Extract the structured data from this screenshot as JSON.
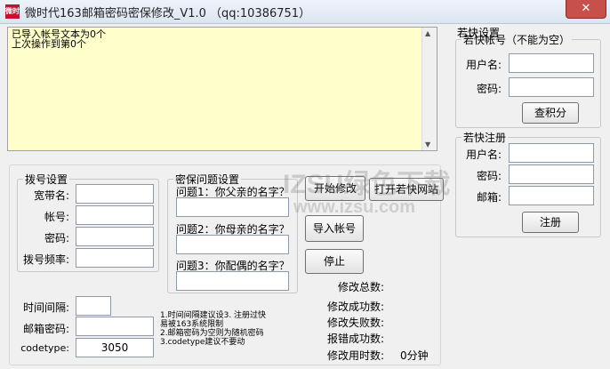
{
  "titlebar": {
    "app_icon_text": "微时",
    "title": "微时代163邮箱密码密保修改_V1.0  （qq:10386751）",
    "close_glyph": "✕"
  },
  "log": {
    "lines": "已导入帐号文本为0个\n上次操作到第0个"
  },
  "dial": {
    "legend": "拨号设置",
    "broadband_label": "宽带名:",
    "account_label": "帐号:",
    "password_label": "密码:",
    "frequency_label": "拨号频率:"
  },
  "security": {
    "legend": "密保问题设置",
    "q1": "问题1：你父亲的名字？",
    "q2": "问题2：你母亲的名字？",
    "q3": "问题3：你配偶的名字？"
  },
  "actions": {
    "start": "开始修改",
    "open_site": "打开若快网站",
    "import": "导入帐号",
    "stop": "停止"
  },
  "stats": {
    "total": "修改总数:",
    "success": "修改成功数:",
    "fail": "修改失败数:",
    "error_success": "报错成功数:",
    "time_used": "修改用时数:",
    "time_value": "0分钟"
  },
  "bottom": {
    "interval_label": "时间间隔:",
    "mail_password_label": "邮箱密码:",
    "codetype_label": "codetype:",
    "codetype_value": "3050",
    "notes": "1.时间间隔建议设3. 注册过快\n易被163系统限制\n2.邮箱密码为空则为随机密码\n3.codetype建议不要动"
  },
  "ruokuai": {
    "legend": "若快设置",
    "account_legend": "若快帐号（不能为空）",
    "username_label": "用户名:",
    "password_label": "密码:",
    "check_points": "查积分",
    "register_legend": "若快注册",
    "reg_username_label": "用户名:",
    "reg_password_label": "密码:",
    "reg_email_label": "邮箱:",
    "register_button": "注册"
  },
  "watermark": {
    "text": "IZSU绿色下载",
    "url": "www.izsu.com"
  }
}
